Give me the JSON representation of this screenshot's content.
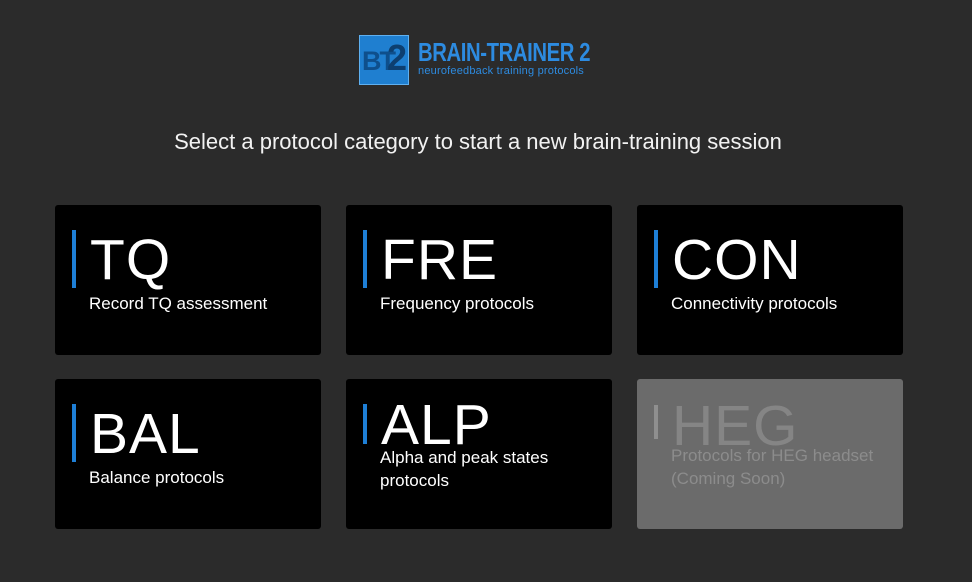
{
  "logo": {
    "badge_text": "BT",
    "badge_number": "2",
    "title": "BRAIN-TRAINER 2",
    "subtitle": "neurofeedback training protocols"
  },
  "prompt": "Select a protocol category to start a new brain-training session",
  "cards": [
    {
      "code": "TQ",
      "description": "Record TQ assessment",
      "enabled": true
    },
    {
      "code": "FRE",
      "description": "Frequency protocols",
      "enabled": true
    },
    {
      "code": "CON",
      "description": "Connectivity protocols",
      "enabled": true
    },
    {
      "code": "BAL",
      "description": "Balance protocols",
      "enabled": true
    },
    {
      "code": "ALP",
      "description": "Alpha and peak states protocols",
      "enabled": true
    },
    {
      "code": "HEG",
      "description": "Protocols for HEG headset (Coming Soon)",
      "enabled": false
    }
  ],
  "colors": {
    "background": "#2b2b2b",
    "card": "#000000",
    "card_disabled": "#6b6b6b",
    "accent": "#1e7fd6"
  }
}
